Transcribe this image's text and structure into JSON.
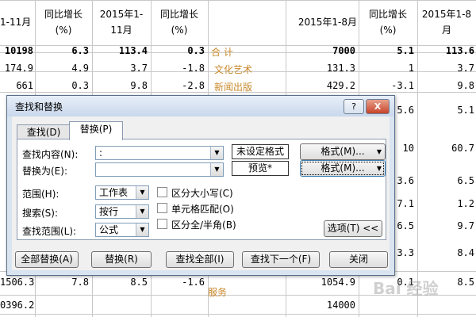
{
  "sheet": {
    "header": {
      "col0": "1-11月",
      "col1": "同比增长\n(%)",
      "col2": "2015年1-\n11月",
      "col3": "同比增长\n(%)",
      "col5": "2015年1-8月",
      "col6": "同比增长\n(%)",
      "col7": "2015年1-8\n月"
    },
    "rows": [
      {
        "c0": "10198",
        "c1": "6.3",
        "c2": "113.4",
        "c3": "0.3",
        "c4": "合 计",
        "c5": "7000",
        "c6": "5.1",
        "c7": "113.6"
      },
      {
        "c0": "174.9",
        "c1": "4.9",
        "c2": "3.7",
        "c3": "-1.8",
        "c4": "文化艺术",
        "c5": "131.3",
        "c6": "1",
        "c7": "3.7"
      },
      {
        "c0": "661",
        "c1": "0.3",
        "c2": "9.8",
        "c3": "-2.8",
        "c4": "新闻出版",
        "c5": "429.2",
        "c6": "-3.1",
        "c7": "9.8"
      }
    ],
    "right_fragments": [
      "5.6",
      "5.1",
      "10",
      "60.7",
      "3.6",
      "6.5",
      "7.1",
      "1.2",
      "6.5",
      "9.7",
      "3.3",
      "8.4"
    ],
    "bottom_rows": [
      {
        "c0": "1506.3",
        "c1": "7.8",
        "c2": "8.5",
        "c3": "-1.6",
        "c5": "1054.9",
        "c6": "0.1",
        "c7": "8.5"
      },
      {
        "c0": "0396.2",
        "c4": "服务",
        "c5": "14000"
      }
    ],
    "watermark": "Bai 经验"
  },
  "dialog": {
    "title": "查找和替换",
    "help": "?",
    "close": "X",
    "tabs": [
      "查找(D)",
      "替换(P)"
    ],
    "find_label": "查找内容(N):",
    "find_value": ":",
    "find_format": "未设定格式",
    "replace_label": "替换为(E):",
    "replace_value": "",
    "replace_format": "预览*",
    "format_btn1": "格式(M)...",
    "format_btn2": "格式(M)...",
    "scope_label": "范围(H):",
    "scope_value": "工作表",
    "search_label": "搜索(S):",
    "search_value": "按行",
    "lookin_label": "查找范围(L):",
    "lookin_value": "公式",
    "check_case": "区分大小写(C)",
    "check_cell": "单元格匹配(O)",
    "check_width": "区分全/半角(B)",
    "options_btn": "选项(T) <<",
    "replace_all": "全部替换(A)",
    "replace": "替换(R)",
    "find_all": "查找全部(I)",
    "find_next": "查找下一个(F)",
    "close_btn": "关闭"
  }
}
